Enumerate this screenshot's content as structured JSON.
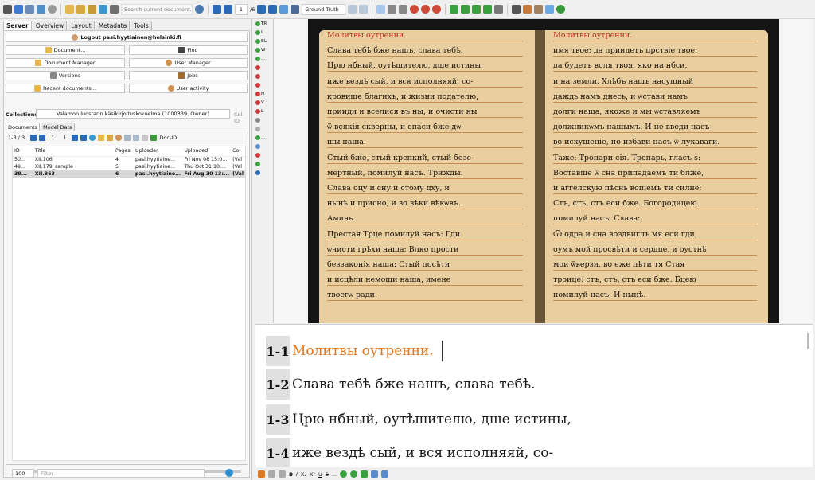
{
  "toolbar": {
    "search_placeholder": "Search current document...",
    "page_current": "1",
    "page_total": "/6",
    "transcript_version": "Ground Truth"
  },
  "left_tabs": [
    "Server",
    "Overview",
    "Layout",
    "Metadata",
    "Tools"
  ],
  "server": {
    "logout_label": "Logout pasi.hyytiainen@helsinki.fi",
    "document_label": "Document...",
    "find_label": "Find",
    "doc_manager_label": "Document Manager",
    "user_manager_label": "User Manager",
    "versions_label": "Versions",
    "jobs_label": "Jobs",
    "recent_label": "Recent documents...",
    "user_activity_label": "User activity",
    "collections_label": "Collections:",
    "collection_value": "Valamon luostarin käsikirjoituskokoelma (1000339, Owner)",
    "col_id_label": "Col-ID"
  },
  "subtabs": [
    "Documents",
    "Model Data"
  ],
  "documents": {
    "range": "1-3 / 3",
    "page_from": "1",
    "page_to": "1",
    "docid_label": "Doc-ID",
    "columns": [
      "ID",
      "Title",
      "Pages",
      "Uploader",
      "Uploaded",
      "Col"
    ],
    "rows": [
      {
        "id": "50...",
        "title": "XII.106",
        "pages": "4",
        "uploader": "pasi.hyytiaine...",
        "uploaded": "Fri Nov 08 15:0...",
        "col": "(Val"
      },
      {
        "id": "49...",
        "title": "XII.179_sample",
        "pages": "5",
        "uploader": "pasi.hyytiaine...",
        "uploaded": "Thu Oct 31 10:...",
        "col": "(Val"
      },
      {
        "id": "39...",
        "title": "XII.363",
        "pages": "6",
        "uploader": "pasi.hyytiaine...",
        "uploaded": "Fri Aug 30 13:...",
        "col": "(Val"
      }
    ],
    "page_size": "100",
    "filter_placeholder": "Filter"
  },
  "vertical_tools": [
    "TR",
    "L",
    "BL",
    "W",
    "...",
    "H",
    "V",
    "L",
    "..."
  ],
  "scan": {
    "left": [
      {
        "text": "Молитвы оутренни.",
        "red": true
      },
      {
        "text": "Слава тебѣ бже нашъ, слава тебѣ.",
        "red": false
      },
      {
        "text": "Црю нбный, оутѣшителю, дше истины,",
        "red": false
      },
      {
        "text": "иже вездѣ сый, и вся исполняяй, со-",
        "red": false
      },
      {
        "text": "кровище благихъ, и жизни подателю,",
        "red": false
      },
      {
        "text": "прииди и вселися въ ны, и очисти ны",
        "red": false
      },
      {
        "text": "ѿ всякія скверны, и спаси бже дѡ-",
        "red": false
      },
      {
        "text": "шы наша.",
        "red": false
      },
      {
        "text": "Стый бже, стый крепкий, стый безс-",
        "red": false
      },
      {
        "text": "мертный, помилуй насъ. Трижды.",
        "red": false
      },
      {
        "text": "Слава оцу и сну и стому дху, и",
        "red": false
      },
      {
        "text": "нынѣ и присно, и во вѣки вѣкѡвъ.",
        "red": false
      },
      {
        "text": "Аминь.",
        "red": false
      },
      {
        "text": "Престая Трце помилуй насъ: Гди",
        "red": false
      },
      {
        "text": "ѡчисти грѣхи наша: Влко прости",
        "red": false
      },
      {
        "text": "беззаконія наша: Стый посѣти",
        "red": false
      },
      {
        "text": "и исцѣли немощи наша, имене",
        "red": false
      },
      {
        "text": "твоегѡ ради.",
        "red": false
      }
    ],
    "right": [
      {
        "text": "Молитвы оутренни.",
        "red": true
      },
      {
        "text": "имя твое: да приидетъ црствіе твое:",
        "red": false
      },
      {
        "text": "да будетъ воля твоя, яко на нбси,",
        "red": false
      },
      {
        "text": "и на земли. Хлѣбъ нашъ насущный",
        "red": false
      },
      {
        "text": "даждь намъ днесь, и ѡстави намъ",
        "red": false
      },
      {
        "text": "долги наша, якоже и мы ѡставляемъ",
        "red": false
      },
      {
        "text": "должникѡмъ нашымъ. И не введи насъ",
        "red": false
      },
      {
        "text": "во искушеніе, но избави насъ ѿ лукаваги.",
        "red": false
      },
      {
        "text": "Таже: Тропари сія. Тропарь, гласъ ѕ:",
        "red": false
      },
      {
        "text": "Воставше ѿ сна припадаемъ ти блже,",
        "red": false
      },
      {
        "text": "и аггелскую пѣснь вопіемъ ти силне:",
        "red": false
      },
      {
        "text": "Стъ, стъ, стъ еси бже. Богородицею",
        "red": false
      },
      {
        "text": "помилуй насъ. Слава:",
        "red": false
      },
      {
        "text": "Ѿ одра и сна воздвиглъ мя еси гди,",
        "red": false
      },
      {
        "text": "оумъ мой просвѣти и сердце, и оустнѣ",
        "red": false
      },
      {
        "text": "мои ѿверзи, во еже пѣти тя Стая",
        "red": false
      },
      {
        "text": "троице: стъ, стъ, стъ еси бже. Бцею",
        "red": false
      },
      {
        "text": "помилуй насъ. И нынѣ.",
        "red": false
      }
    ]
  },
  "editor": {
    "lines": [
      {
        "num": "1-1",
        "text": "Молитвы оутренни.",
        "red": true
      },
      {
        "num": "1-2",
        "text": "Слава тебѣ бже нашъ, слава тебѣ.",
        "red": false
      },
      {
        "num": "1-3",
        "text": "Црю нбный, оутѣшителю, дше истины,",
        "red": false
      },
      {
        "num": "1-4",
        "text": "иже вездѣ сый, и вся исполняяй, со-",
        "red": false
      }
    ]
  },
  "format_bar": [
    "B",
    "I",
    "X₂",
    "X²",
    "U",
    "S",
    "..."
  ],
  "colors": {
    "accent": "#2a8fd0",
    "rubric": "#e07820",
    "parchment": "#e9cfa0"
  }
}
